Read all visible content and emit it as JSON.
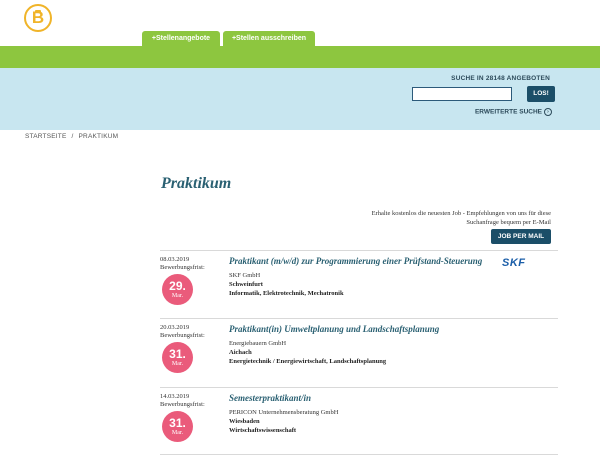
{
  "logo": {
    "letter": "B"
  },
  "tabs": [
    {
      "label": "+Stellenangebote"
    },
    {
      "label": "+Stellen ausschreiben"
    }
  ],
  "search": {
    "label": "SUCHE IN 28148 ANGEBOTEN",
    "value": "",
    "button": "LOS!",
    "advanced": "ERWEITERTE SUCHE"
  },
  "breadcrumb": {
    "home": "STARTSEITE",
    "sep": "/",
    "current": "PRAKTIKUM"
  },
  "page_title": "Praktikum",
  "alert": {
    "text": "Erhalte kostenlos die neuesten Job - Empfehlungen von uns für diese Suchanfrage bequem per E-Mail",
    "button": "JOB PER MAIL"
  },
  "jobs": [
    {
      "date": "08.03.2019",
      "deadline_label": "Bewerbungsfrist:",
      "day": "29.",
      "month": "Mar.",
      "title": "Praktikant (m/w/d) zur Programmierung einer Prüfstand-Steuerung",
      "company": "SKF GmbH",
      "city": "Schweinfurt",
      "field": "Informatik, Elektrotechnik, Mechatronik",
      "logo_text": "SKF"
    },
    {
      "date": "20.03.2019",
      "deadline_label": "Bewerbungsfrist:",
      "day": "31.",
      "month": "Mar.",
      "title": "Praktikant(in) Umweltplanung und Landschaftsplanung",
      "company": "Energiebauern GmbH",
      "city": "Aichach",
      "field": "Energietechnik / Energiewirtschaft, Landschaftsplanung"
    },
    {
      "date": "14.03.2019",
      "deadline_label": "Bewerbungsfrist:",
      "day": "31.",
      "month": "Mar.",
      "title": "Semesterpraktikant/in",
      "company": "PERICON Unternehmensberatung GmbH",
      "city": "Wiesbaden",
      "field": "Wirtschaftswissenschaft"
    }
  ]
}
